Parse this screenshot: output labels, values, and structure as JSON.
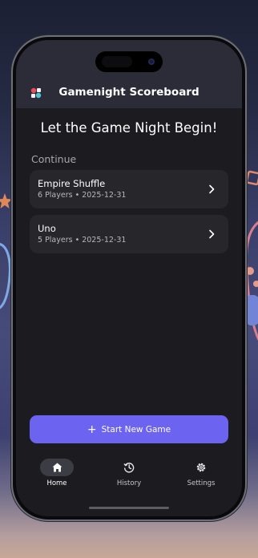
{
  "header": {
    "title": "Gamenight Scoreboard",
    "logo_icon": "game-controller-icon"
  },
  "hero": {
    "text": "Let the Game Night Begin!"
  },
  "continue": {
    "label": "Continue",
    "games": [
      {
        "name": "Empire Shuffle",
        "meta": "6 Players • 2025-12-31"
      },
      {
        "name": "Uno",
        "meta": "5 Players • 2025-12-31"
      }
    ]
  },
  "start_button": {
    "label": "Start New Game"
  },
  "nav": {
    "items": [
      {
        "label": "Home",
        "icon": "home-icon",
        "active": true
      },
      {
        "label": "History",
        "icon": "history-icon",
        "active": false
      },
      {
        "label": "Settings",
        "icon": "gear-icon",
        "active": false
      }
    ]
  },
  "colors": {
    "accent": "#6c63f1",
    "background": "#1c1c20",
    "card": "#26262b",
    "header": "#2b2c38"
  }
}
